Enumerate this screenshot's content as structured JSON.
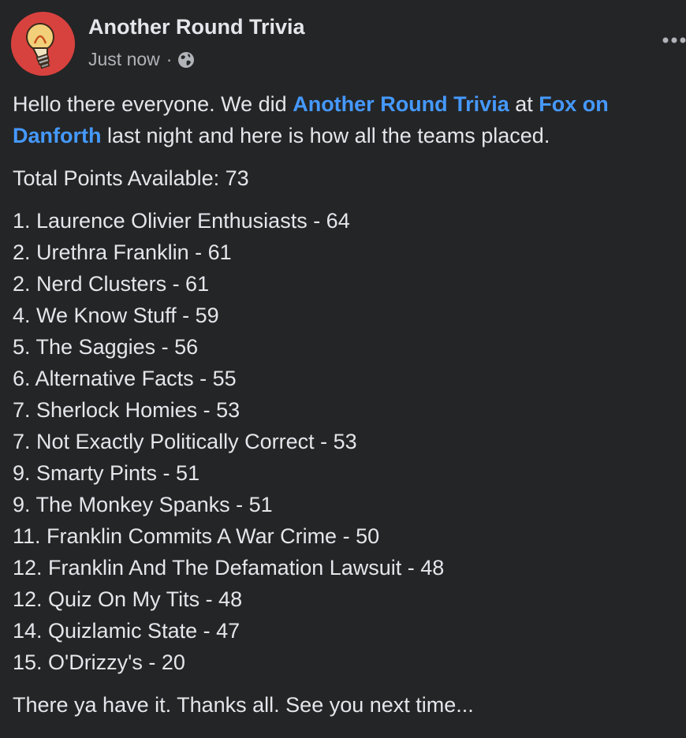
{
  "post": {
    "author": "Another Round Trivia",
    "timestamp": "Just now",
    "separator": "·",
    "audience_icon": "globe-icon",
    "more_icon": "more-options-icon",
    "intro": {
      "part1": "Hello there everyone. We did ",
      "link1": "Another Round Trivia",
      "part2": " at ",
      "link2": "Fox on Danforth",
      "part3": " last night and here is how all the teams placed."
    },
    "total_points": "Total Points Available: 73",
    "standings": [
      "1. Laurence Olivier Enthusiasts - 64",
      "2. Urethra Franklin - 61",
      "2. Nerd Clusters - 61",
      "4. We Know Stuff - 59",
      "5. The Saggies - 56",
      "6. Alternative Facts - 55",
      "7. Sherlock Homies - 53",
      "7. Not Exactly Politically Correct - 53",
      "9. Smarty Pints - 51",
      "9. The Monkey Spanks - 51",
      "11. Franklin Commits A War Crime - 50",
      "12. Franklin And The Defamation Lawsuit - 48",
      "12. Quiz On My Tits - 48",
      "14. Quizlamic State - 47",
      "15. O'Drizzy's - 20"
    ],
    "closing": "There ya have it. Thanks all. See you next time..."
  },
  "colors": {
    "background": "#242526",
    "text": "#e4e6eb",
    "secondary_text": "#b0b3b8",
    "link": "#4599ff",
    "avatar_bg": "#d8423e"
  }
}
